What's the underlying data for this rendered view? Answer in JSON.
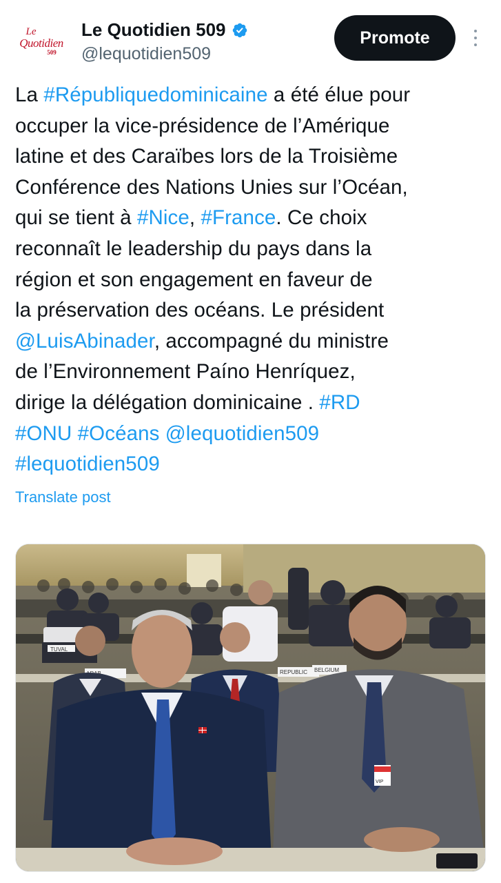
{
  "account": {
    "avatar_lines": [
      "Le",
      "Quotidien",
      "509"
    ],
    "display_name": "Le Quotidien 509",
    "handle": "@lequotidien509",
    "verified": true,
    "verified_icon": "verified-badge-icon",
    "verified_color": "#1d9bf0"
  },
  "actions": {
    "promote_label": "Promote",
    "more_icon": "more-vertical-icon"
  },
  "post": {
    "lines": [
      [
        {
          "t": "La "
        },
        {
          "t": "#Républiquedominicaine",
          "link": true
        },
        {
          "t": " a été élue pour"
        }
      ],
      [
        {
          "t": "occuper la vice-présidence de l’Amérique"
        }
      ],
      [
        {
          "t": "latine et des Caraïbes lors de la Troisième"
        }
      ],
      [
        {
          "t": "Conférence des Nations Unies sur l’Océan,"
        }
      ],
      [
        {
          "t": "qui se tient à "
        },
        {
          "t": "#Nice",
          "link": true
        },
        {
          "t": ", "
        },
        {
          "t": "#France",
          "link": true
        },
        {
          "t": ". Ce choix"
        }
      ],
      [
        {
          "t": "reconnaît le leadership du pays dans la"
        }
      ],
      [
        {
          "t": "région et son engagement en faveur de"
        }
      ],
      [
        {
          "t": "la préservation des océans. Le président"
        }
      ],
      [
        {
          "t": "@LuisAbinader",
          "link": true
        },
        {
          "t": ", accompagné du ministre"
        }
      ],
      [
        {
          "t": "de l’Environnement Paíno Henríquez,"
        }
      ],
      [
        {
          "t": "dirige la délégation dominicaine . "
        },
        {
          "t": "#RD",
          "link": true
        }
      ],
      [
        {
          "t": "#ONU",
          "link": true
        },
        {
          "t": " "
        },
        {
          "t": "#Océans",
          "link": true
        },
        {
          "t": " "
        },
        {
          "t": "@lequotidien509",
          "link": true
        }
      ],
      [
        {
          "t": "#lequotidien509",
          "link": true
        }
      ]
    ],
    "translate_label": "Translate post",
    "link_color": "#1d9bf0"
  },
  "media": {
    "nameplates": [
      "TUVAL",
      "ARAB",
      "REPUBLIC",
      "BELGIUM",
      "VIP"
    ]
  }
}
